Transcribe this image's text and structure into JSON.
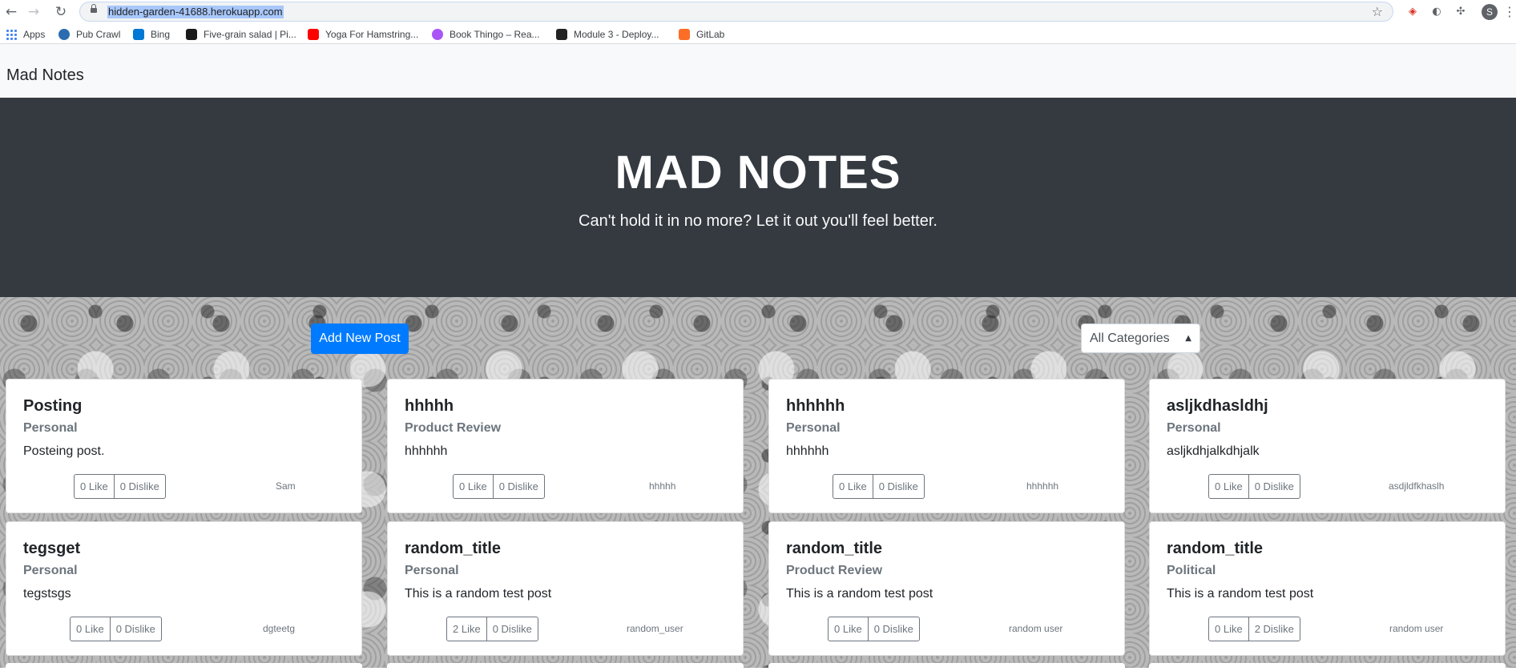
{
  "browser": {
    "url": "hidden-garden-41688.herokuapp.com",
    "profile_initial": "S",
    "bookmarks": [
      {
        "label": "Apps"
      },
      {
        "label": "Pub Crawl"
      },
      {
        "label": "Bing"
      },
      {
        "label": "Five-grain salad | Pi..."
      },
      {
        "label": "Yoga For Hamstring..."
      },
      {
        "label": "Book Thingo – Rea..."
      },
      {
        "label": "Module 3 - Deploy..."
      },
      {
        "label": "GitLab"
      }
    ]
  },
  "navbar": {
    "brand": "Mad Notes"
  },
  "hero": {
    "title": "MAD NOTES",
    "subtitle": "Can't hold it in no more? Let it out you'll feel better."
  },
  "controls": {
    "add_post_label": "Add New Post",
    "category_selected": "All Categories"
  },
  "posts": [
    {
      "title": "Posting",
      "category": "Personal",
      "body": "Posteing post.",
      "like": "0 Like",
      "dislike": "0 Dislike",
      "author": "Sam"
    },
    {
      "title": "hhhhh",
      "category": "Product Review",
      "body": "hhhhhh",
      "like": "0 Like",
      "dislike": "0 Dislike",
      "author": "hhhhh"
    },
    {
      "title": "hhhhhh",
      "category": "Personal",
      "body": "hhhhhh",
      "like": "0 Like",
      "dislike": "0 Dislike",
      "author": "hhhhhh"
    },
    {
      "title": "asljkdhasldhj",
      "category": "Personal",
      "body": "asljkdhjalkdhjalk",
      "like": "0 Like",
      "dislike": "0 Dislike",
      "author": "asdjldfkhaslh"
    },
    {
      "title": "tegsget",
      "category": "Personal",
      "body": "tegstsgs",
      "like": "0 Like",
      "dislike": "0 Dislike",
      "author": "dgteetg"
    },
    {
      "title": "random_title",
      "category": "Personal",
      "body": "This is a random test post",
      "like": "2 Like",
      "dislike": "0 Dislike",
      "author": "random_user"
    },
    {
      "title": "random_title",
      "category": "Product Review",
      "body": "This is a random test post",
      "like": "0 Like",
      "dislike": "0 Dislike",
      "author": "random user"
    },
    {
      "title": "random_title",
      "category": "Political",
      "body": "This is a random test post",
      "like": "0 Like",
      "dislike": "2 Dislike",
      "author": "random user"
    }
  ]
}
